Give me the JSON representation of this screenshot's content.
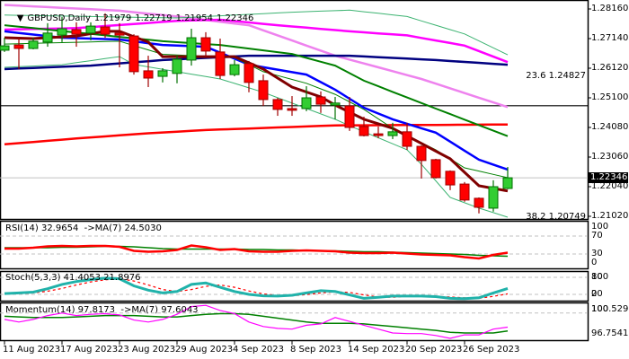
{
  "header": {
    "symbol_timeframe": "GBPUSD,Daily",
    "open": "1.21979",
    "high": "1.22719",
    "low": "1.21954",
    "close": "1.22346"
  },
  "price_axis": {
    "labels": [
      "1.28160",
      "1.27140",
      "1.26120",
      "1.25100",
      "1.24080",
      "1.23060",
      "1.22040",
      "1.21020"
    ],
    "current_price": "1.22346"
  },
  "fib": {
    "level_236_label": "23.6 1.24827",
    "level_382_label": "38.2 1.20749"
  },
  "rsi": {
    "label": "RSI(14) 32.9654  ->MA(7) 24.5030",
    "axis_labels": [
      {
        "text": "100",
        "value": 100
      },
      {
        "text": "70",
        "value": 70
      },
      {
        "text": "30",
        "value": 30
      },
      {
        "text": "0",
        "value": 0
      }
    ]
  },
  "stoch": {
    "label": "Stoch(5,3,3) 41.4053 21.8976",
    "axis_labels": [
      {
        "text": "100",
        "value": 80
      },
      {
        "text": "80",
        "value": 80
      },
      {
        "text": "20",
        "value": 20
      },
      {
        "text": "0",
        "value": 20
      }
    ]
  },
  "momentum": {
    "label": "Momentum(14) 97.8173  ->MA(7) 97.6043",
    "axis_labels": [
      {
        "text": "100",
        "value": 100.529
      },
      {
        "text": "100.529",
        "value": 100.529
      },
      {
        "text": "96.7541",
        "value": 96.7541
      }
    ]
  },
  "date_axis": [
    {
      "index": 0,
      "label": "11 Aug 2023"
    },
    {
      "index": 4,
      "label": "17 Aug 2023"
    },
    {
      "index": 8,
      "label": "23 Aug 2023"
    },
    {
      "index": 12,
      "label": "29 Aug 2023"
    },
    {
      "index": 16,
      "label": "4 Sep 2023"
    },
    {
      "index": 20,
      "label": "8 Sep 2023"
    },
    {
      "index": 24,
      "label": "14 Sep 2023"
    },
    {
      "index": 28,
      "label": "20 Sep 2023"
    },
    {
      "index": 32,
      "label": "26 Sep 2023"
    }
  ],
  "colors": {
    "bull": "#32cd32",
    "bull_border": "#007000",
    "bear": "#ff0000",
    "bear_border": "#a00000",
    "grid_dash": "#c0c0c0",
    "price_line": "#c0c0c0"
  },
  "chart_data": {
    "type": "candlestick",
    "title": "GBPUSD,Daily",
    "ylim": [
      1.20927,
      1.28469
    ],
    "price_ticks": [
      1.2816,
      1.2714,
      1.2612,
      1.251,
      1.2408,
      1.2306,
      1.2204,
      1.2102
    ],
    "current_price": 1.22346,
    "fib_236_price": 1.24827,
    "ohlc": [
      [
        1.2674,
        1.2717,
        1.2668,
        1.2689
      ],
      [
        1.2692,
        1.2717,
        1.2609,
        1.268
      ],
      [
        1.268,
        1.2717,
        1.2677,
        1.2705
      ],
      [
        1.2702,
        1.2767,
        1.2686,
        1.2733
      ],
      [
        1.2726,
        1.2788,
        1.2702,
        1.2748
      ],
      [
        1.2745,
        1.277,
        1.2686,
        1.2729
      ],
      [
        1.2733,
        1.277,
        1.2708,
        1.2757
      ],
      [
        1.2754,
        1.2801,
        1.2717,
        1.2729
      ],
      [
        1.2733,
        1.2767,
        1.2615,
        1.2726
      ],
      [
        1.2723,
        1.2729,
        1.259,
        1.26
      ],
      [
        1.2603,
        1.2655,
        1.2547,
        1.2578
      ],
      [
        1.2584,
        1.2612,
        1.2563,
        1.2603
      ],
      [
        1.2594,
        1.2655,
        1.256,
        1.2643
      ],
      [
        1.264,
        1.2748,
        1.2621,
        1.2717
      ],
      [
        1.2717,
        1.2736,
        1.2652,
        1.2671
      ],
      [
        1.2668,
        1.2714,
        1.2575,
        1.2587
      ],
      [
        1.259,
        1.264,
        1.2584,
        1.2624
      ],
      [
        1.2628,
        1.2637,
        1.2529,
        1.2563
      ],
      [
        1.2569,
        1.259,
        1.2482,
        1.2504
      ],
      [
        1.2504,
        1.251,
        1.2448,
        1.247
      ],
      [
        1.2473,
        1.2516,
        1.2448,
        1.2467
      ],
      [
        1.2473,
        1.255,
        1.2464,
        1.251
      ],
      [
        1.2513,
        1.2532,
        1.2458,
        1.2488
      ],
      [
        1.2485,
        1.2513,
        1.2436,
        1.2492
      ],
      [
        1.2482,
        1.2513,
        1.2396,
        1.2408
      ],
      [
        1.2411,
        1.2445,
        1.2377,
        1.238
      ],
      [
        1.2386,
        1.2411,
        1.2371,
        1.238
      ],
      [
        1.238,
        1.2424,
        1.2368,
        1.2393
      ],
      [
        1.2393,
        1.2424,
        1.2331,
        1.2343
      ],
      [
        1.2343,
        1.2346,
        1.2232,
        1.2294
      ],
      [
        1.2297,
        1.23,
        1.2232,
        1.2235
      ],
      [
        1.2257,
        1.226,
        1.2192,
        1.221
      ],
      [
        1.2213,
        1.222,
        1.2152,
        1.2158
      ],
      [
        1.2164,
        1.2167,
        1.2112,
        1.2133
      ],
      [
        1.213,
        1.2226,
        1.2118,
        1.2204
      ],
      [
        1.21979,
        1.22719,
        1.21954,
        1.22346
      ]
    ],
    "overlays": [
      {
        "name": "red-long-ma",
        "color": "#ff0000",
        "points": [
          [
            0,
            1.235
          ],
          [
            5,
            1.237
          ],
          [
            10,
            1.2388
          ],
          [
            14,
            1.2399
          ],
          [
            23,
            1.2415
          ],
          [
            35,
            1.2418
          ]
        ]
      },
      {
        "name": "violet-ma",
        "color": "#ee82ee",
        "points": [
          [
            0,
            1.283
          ],
          [
            8,
            1.281
          ],
          [
            12,
            1.279
          ],
          [
            17,
            1.276
          ],
          [
            23,
            1.2655
          ],
          [
            29,
            1.2575
          ],
          [
            35,
            1.2478
          ]
        ]
      },
      {
        "name": "upper-band",
        "color": "#3cb371",
        "points": [
          [
            0,
            1.2795
          ],
          [
            12,
            1.2785
          ],
          [
            20,
            1.2805
          ],
          [
            24,
            1.2812
          ],
          [
            28,
            1.279
          ],
          [
            32,
            1.273
          ],
          [
            35,
            1.2658
          ]
        ]
      },
      {
        "name": "magenta-ma",
        "color": "#ff00ff",
        "points": [
          [
            0,
            1.2745
          ],
          [
            5,
            1.275
          ],
          [
            12,
            1.2775
          ],
          [
            15,
            1.2779
          ],
          [
            19,
            1.276
          ],
          [
            24,
            1.2739
          ],
          [
            28,
            1.2725
          ],
          [
            32,
            1.269
          ],
          [
            35,
            1.2633
          ]
        ]
      },
      {
        "name": "navy-ma",
        "color": "#000080",
        "points": [
          [
            0,
            1.2609
          ],
          [
            6,
            1.2621
          ],
          [
            11,
            1.264
          ],
          [
            17,
            1.2655
          ],
          [
            24,
            1.2655
          ],
          [
            30,
            1.264
          ],
          [
            35,
            1.2624
          ]
        ]
      },
      {
        "name": "green-ma",
        "color": "#008000",
        "points": [
          [
            0,
            1.276
          ],
          [
            11,
            1.2705
          ],
          [
            15,
            1.2692
          ],
          [
            20,
            1.2661
          ],
          [
            23,
            1.2621
          ],
          [
            25,
            1.2569
          ],
          [
            29,
            1.2492
          ],
          [
            35,
            1.2378
          ]
        ]
      },
      {
        "name": "blue-ma",
        "color": "#0000ff",
        "points": [
          [
            0,
            1.2739
          ],
          [
            4,
            1.2717
          ],
          [
            8,
            1.2711
          ],
          [
            11,
            1.2692
          ],
          [
            14,
            1.2686
          ],
          [
            17,
            1.2624
          ],
          [
            21,
            1.259
          ],
          [
            23,
            1.2538
          ],
          [
            25,
            1.2476
          ],
          [
            27,
            1.2436
          ],
          [
            30,
            1.239
          ],
          [
            33,
            1.2297
          ],
          [
            35,
            1.2263
          ]
        ]
      },
      {
        "name": "middle-band",
        "color": "#008000",
        "points": [
          [
            0,
            1.2695
          ],
          [
            8,
            1.2705
          ],
          [
            11,
            1.266
          ],
          [
            16,
            1.2648
          ],
          [
            18,
            1.26
          ],
          [
            21,
            1.256
          ],
          [
            23,
            1.2522
          ],
          [
            25,
            1.247
          ],
          [
            27,
            1.2405
          ],
          [
            30,
            1.2331
          ],
          [
            32,
            1.2269
          ],
          [
            35,
            1.2235
          ]
        ]
      },
      {
        "name": "lower-band",
        "color": "#3cb371",
        "points": [
          [
            0,
            1.2615
          ],
          [
            4,
            1.2624
          ],
          [
            8,
            1.2652
          ],
          [
            9,
            1.2625
          ],
          [
            12,
            1.26
          ],
          [
            15,
            1.2575
          ],
          [
            18,
            1.2529
          ],
          [
            23,
            1.2436
          ],
          [
            24,
            1.2414
          ],
          [
            28,
            1.2331
          ],
          [
            29,
            1.2281
          ],
          [
            31,
            1.2167
          ],
          [
            33,
            1.213
          ],
          [
            35,
            1.2099
          ]
        ]
      },
      {
        "name": "brown-ma",
        "color": "#800000",
        "points": [
          [
            0,
            1.2717
          ],
          [
            2,
            1.2714
          ],
          [
            5,
            1.2723
          ],
          [
            7,
            1.2739
          ],
          [
            8,
            1.2739
          ],
          [
            10,
            1.2702
          ],
          [
            11,
            1.2652
          ],
          [
            16,
            1.2652
          ],
          [
            18,
            1.2609
          ],
          [
            20,
            1.2547
          ],
          [
            22,
            1.2513
          ],
          [
            23,
            1.2485
          ],
          [
            25,
            1.2436
          ],
          [
            27,
            1.2405
          ],
          [
            29,
            1.2353
          ],
          [
            31,
            1.23
          ],
          [
            33,
            1.2207
          ],
          [
            35,
            1.2189
          ]
        ]
      }
    ],
    "rsi": {
      "ylim": [
        -2,
        104
      ],
      "levels": [
        70,
        30
      ],
      "color": "#ff0000",
      "ma_color": "#008000",
      "values": [
        42,
        42,
        44,
        47,
        48,
        47,
        48,
        48,
        46,
        37,
        35,
        36,
        39,
        49,
        45,
        39,
        41,
        36,
        35,
        35,
        37,
        38,
        37,
        36,
        33,
        32,
        32,
        33,
        31,
        29,
        28,
        27,
        23,
        20,
        28,
        33
      ],
      "ma": [
        44,
        44,
        44,
        44,
        45,
        45,
        46,
        47,
        47,
        46,
        44,
        42,
        41,
        41,
        41,
        41,
        41,
        40,
        40,
        39,
        39,
        38,
        37,
        37,
        36,
        35,
        35,
        34,
        33,
        32,
        31,
        30,
        29,
        27,
        26,
        25
      ]
    },
    "stoch": {
      "ylim": [
        -2.1,
        102.1
      ],
      "levels": [
        80,
        20
      ],
      "color": "#20b2aa",
      "signal_color": "#ff0000",
      "main": [
        23,
        25,
        28,
        40,
        55,
        65,
        72,
        77,
        75,
        50,
        35,
        25,
        30,
        55,
        60,
        45,
        30,
        20,
        15,
        14,
        17,
        25,
        33,
        30,
        18,
        6,
        10,
        14,
        14,
        14,
        12,
        6,
        5,
        8,
        25,
        41
      ],
      "signal": [
        22,
        23,
        25,
        31,
        41,
        53,
        64,
        71,
        75,
        67,
        53,
        37,
        30,
        37,
        48,
        53,
        45,
        32,
        22,
        16,
        15,
        19,
        25,
        29,
        27,
        18,
        11,
        10,
        13,
        14,
        13,
        11,
        8,
        6,
        13,
        22
      ]
    },
    "momentum": {
      "ylim": [
        95.775,
        101.647
      ],
      "levels": [
        100
      ],
      "color": "#ff00ff",
      "ma_color": "#008000",
      "values": [
        99.0,
        98.6,
        99.0,
        99.6,
        100.0,
        99.6,
        99.8,
        99.9,
        99.7,
        98.9,
        98.6,
        99.0,
        99.8,
        101.0,
        101.2,
        100.4,
        99.9,
        98.6,
        97.9,
        97.6,
        97.5,
        98.1,
        98.3,
        99.3,
        98.7,
        98.1,
        97.5,
        96.9,
        96.8,
        96.8,
        96.5,
        96.05,
        96.6,
        96.6,
        97.5,
        97.8
      ],
      "ma": [
        99.5,
        99.4,
        99.3,
        99.3,
        99.3,
        99.4,
        99.5,
        99.6,
        99.6,
        99.6,
        99.5,
        99.4,
        99.4,
        99.6,
        99.8,
        99.9,
        99.9,
        99.8,
        99.5,
        99.2,
        98.9,
        98.6,
        98.4,
        98.4,
        98.4,
        98.3,
        98.1,
        97.9,
        97.7,
        97.5,
        97.3,
        97.0,
        96.9,
        96.9,
        96.9,
        97.2
      ]
    }
  }
}
